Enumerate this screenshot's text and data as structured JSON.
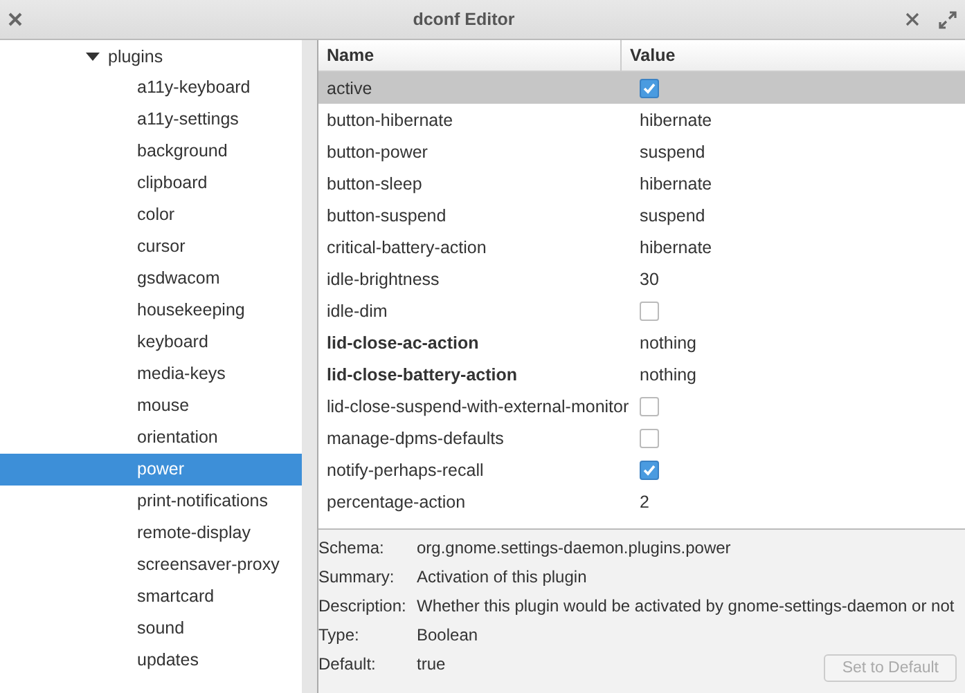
{
  "window": {
    "title": "dconf Editor"
  },
  "tree": [
    {
      "label": "plugins",
      "expanded": true,
      "children": [
        {
          "label": "a11y-keyboard",
          "selected": false
        },
        {
          "label": "a11y-settings",
          "selected": false
        },
        {
          "label": "background",
          "selected": false
        },
        {
          "label": "clipboard",
          "selected": false
        },
        {
          "label": "color",
          "selected": false
        },
        {
          "label": "cursor",
          "selected": false
        },
        {
          "label": "gsdwacom",
          "selected": false
        },
        {
          "label": "housekeeping",
          "selected": false
        },
        {
          "label": "keyboard",
          "selected": false
        },
        {
          "label": "media-keys",
          "selected": false
        },
        {
          "label": "mouse",
          "selected": false
        },
        {
          "label": "orientation",
          "selected": false
        },
        {
          "label": "power",
          "selected": true
        },
        {
          "label": "print-notifications",
          "selected": false
        },
        {
          "label": "remote-display",
          "selected": false
        },
        {
          "label": "screensaver-proxy",
          "selected": false
        },
        {
          "label": "smartcard",
          "selected": false
        },
        {
          "label": "sound",
          "selected": false
        },
        {
          "label": "updates",
          "selected": false
        }
      ]
    }
  ],
  "table": {
    "columns": [
      "Name",
      "Value"
    ],
    "rows": [
      {
        "name": "active",
        "kind": "checkbox",
        "checked": true,
        "bold": false,
        "selected": true
      },
      {
        "name": "button-hibernate",
        "kind": "text",
        "value": "hibernate",
        "bold": false,
        "selected": false
      },
      {
        "name": "button-power",
        "kind": "text",
        "value": "suspend",
        "bold": false,
        "selected": false
      },
      {
        "name": "button-sleep",
        "kind": "text",
        "value": "hibernate",
        "bold": false,
        "selected": false
      },
      {
        "name": "button-suspend",
        "kind": "text",
        "value": "suspend",
        "bold": false,
        "selected": false
      },
      {
        "name": "critical-battery-action",
        "kind": "text",
        "value": "hibernate",
        "bold": false,
        "selected": false
      },
      {
        "name": "idle-brightness",
        "kind": "text",
        "value": "30",
        "bold": false,
        "selected": false
      },
      {
        "name": "idle-dim",
        "kind": "checkbox",
        "checked": false,
        "bold": false,
        "selected": false
      },
      {
        "name": "lid-close-ac-action",
        "kind": "text",
        "value": "nothing",
        "bold": true,
        "selected": false
      },
      {
        "name": "lid-close-battery-action",
        "kind": "text",
        "value": "nothing",
        "bold": true,
        "selected": false
      },
      {
        "name": "lid-close-suspend-with-external-monitor",
        "kind": "checkbox",
        "checked": false,
        "bold": false,
        "selected": false
      },
      {
        "name": "manage-dpms-defaults",
        "kind": "checkbox",
        "checked": false,
        "bold": false,
        "selected": false
      },
      {
        "name": "notify-perhaps-recall",
        "kind": "checkbox",
        "checked": true,
        "bold": false,
        "selected": false
      },
      {
        "name": "percentage-action",
        "kind": "text",
        "value": "2",
        "bold": false,
        "selected": false
      }
    ]
  },
  "details": [
    {
      "label": "Schema:",
      "value": "org.gnome.settings-daemon.plugins.power"
    },
    {
      "label": "Summary:",
      "value": "Activation of this plugin"
    },
    {
      "label": "Description:",
      "value": "Whether this plugin would be activated by gnome-settings-daemon or not"
    },
    {
      "label": "Type:",
      "value": "Boolean"
    },
    {
      "label": "Default:",
      "value": "true"
    }
  ],
  "default_button": {
    "label": "Set to Default",
    "disabled": true
  }
}
